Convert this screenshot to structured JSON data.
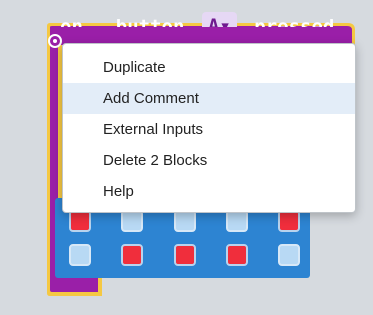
{
  "event_block": {
    "keyword_on": "on",
    "keyword_button": "button",
    "button_value": "A",
    "keyword_pressed": "pressed",
    "color": "#9a1fa8",
    "outline_color": "#f5c842"
  },
  "context_menu": {
    "items": [
      {
        "label": "Duplicate",
        "highlighted": false
      },
      {
        "label": "Add Comment",
        "highlighted": true
      },
      {
        "label": "External Inputs",
        "highlighted": false
      },
      {
        "label": "Delete 2 Blocks",
        "highlighted": false
      },
      {
        "label": "Help",
        "highlighted": false
      }
    ],
    "highlight_color": "#e3edf8"
  },
  "led_grid": {
    "color": "#2d84d2",
    "rows": [
      [
        1,
        0,
        0,
        0,
        1
      ],
      [
        0,
        1,
        1,
        1,
        0
      ]
    ]
  }
}
